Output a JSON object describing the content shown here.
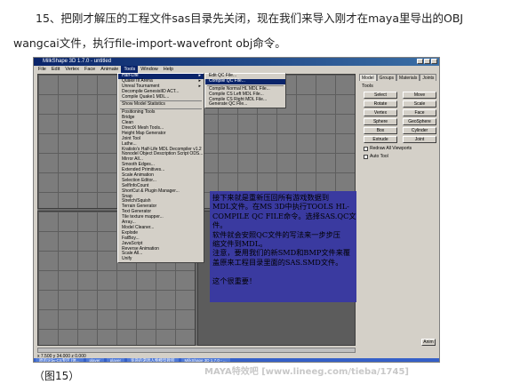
{
  "article": {
    "para1": "15、把刚才解压的工程文件sas目录先关闭，现在我们来导入刚才在maya里导出的OBJ",
    "para2": "wangcai文件，执行file-import-wavefront obj命令。",
    "caption": "（图15）",
    "watermark": "MAYA特效吧 [www.lineeg.com/tieba/1745]"
  },
  "window": {
    "title": "MilkShape 3D 1.7.0 - untitled"
  },
  "menubar": [
    "File",
    "Edit",
    "Vertex",
    "Face",
    "Animate",
    "Tools",
    "Window",
    "Help"
  ],
  "tools_menu": [
    {
      "label": "Half-Life",
      "submenu": true,
      "highlight": true
    },
    {
      "label": "Quake III Arena",
      "submenu": true
    },
    {
      "label": "Unreal Tournament",
      "submenu": true
    },
    {
      "label": "Decompile GenesisIID ACT...",
      "submenu": false
    },
    {
      "label": "Compile Quake1 MDL...",
      "submenu": false
    },
    {
      "sep": true
    },
    {
      "label": "Show Model Statistics"
    },
    {
      "sep": true
    },
    {
      "label": "Positioning Tools"
    },
    {
      "label": "Bridge"
    },
    {
      "label": "Clean"
    },
    {
      "label": "DirectX Mesh Tools..."
    },
    {
      "label": "Height Map Generator"
    },
    {
      "label": "Joint Tool"
    },
    {
      "label": "Lathe..."
    },
    {
      "label": "Kratisto's Half-Life MDL Decompiler v1.2"
    },
    {
      "label": "Nonodel Object Description Script ODS..."
    },
    {
      "label": "Mirror All..."
    },
    {
      "label": "Smooth Edges..."
    },
    {
      "label": "Extended Primitives..."
    },
    {
      "label": "Scale Animation"
    },
    {
      "label": "Selection Editor..."
    },
    {
      "label": "SelfInfoCount"
    },
    {
      "label": "ShortCut & Plugin Manager..."
    },
    {
      "label": "Snap"
    },
    {
      "label": "Stretch/Squish"
    },
    {
      "label": "Terrain Generator"
    },
    {
      "label": "Text Generator"
    },
    {
      "label": "Tile texture mapper..."
    },
    {
      "label": "Array..."
    },
    {
      "label": "Model Cleaner..."
    },
    {
      "label": "Explode"
    },
    {
      "label": "FatBoy..."
    },
    {
      "label": "JavaScript"
    },
    {
      "label": "Reverse Animation"
    },
    {
      "label": "Scale All..."
    },
    {
      "label": "Unify"
    }
  ],
  "halflife_submenu": [
    {
      "label": "Edit QC File..."
    },
    {
      "label": "Compile QC File...",
      "highlight": true
    },
    {
      "sep": true
    },
    {
      "label": "Compile Normal HL MDL File..."
    },
    {
      "label": "Compile CS Left MDL File..."
    },
    {
      "label": "Compile CS Right MDL File..."
    },
    {
      "label": "Generate QC File..."
    }
  ],
  "panel": {
    "tabs": [
      "Model",
      "Groups",
      "Materials",
      "Joints"
    ],
    "tools_label": "Tools",
    "buttons": [
      "Select",
      "Move",
      "Rotate",
      "Scale",
      "Vertex",
      "Face",
      "Sphere",
      "GeoSphere",
      "Box",
      "Cylinder",
      "Extrude",
      "Joint"
    ],
    "checkboxes": [
      "Redraw All Viewports",
      "Auto Tool"
    ],
    "anim_button": "Anim"
  },
  "status": {
    "coords": "x 7.500 y 34.000 z 0.000"
  },
  "taskbar": [
    "原鸡论坛-CS专区 [体...",
    "player",
    "player",
    "宽哥的游戏人物模型教程",
    "MilkShape 3D 1.7.0 - ..."
  ],
  "overlay_lines": [
    "接下来就是重新压回所有游戏数据到",
    "MDL文件。在MS 3D中执行TOOLS HL-",
    "COMPILE QC FILE命令。选择SAS.QC文",
    "件。",
    "软件就会安照QC文件的写法来一步步压",
    "缩文件到MDL。",
    "注意，要用我们的新SMD和BMP文件来覆",
    "盖原来工程目录里面的SAS.SMD文件。",
    "",
    "这个很重要！"
  ]
}
